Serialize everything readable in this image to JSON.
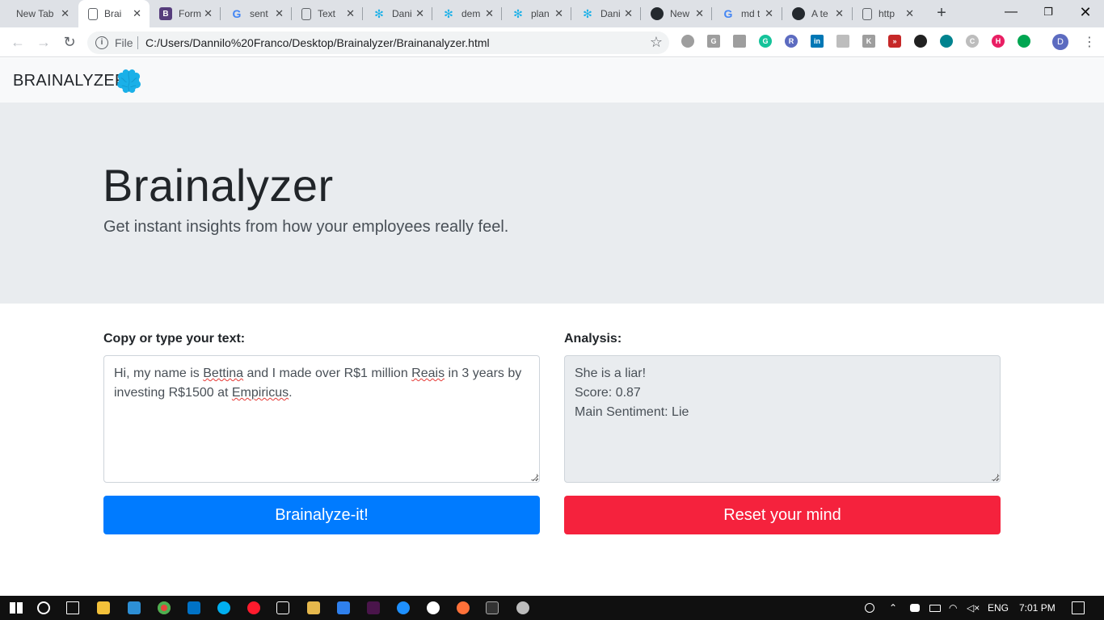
{
  "browser": {
    "tabs": [
      {
        "title": "New Tab",
        "icon": "none"
      },
      {
        "title": "Brai",
        "icon": "page-icon"
      },
      {
        "title": "Form",
        "icon": "bootstrap-icon"
      },
      {
        "title": "sent",
        "icon": "google-icon"
      },
      {
        "title": "Text",
        "icon": "page-icon"
      },
      {
        "title": "Dani",
        "icon": "network-icon"
      },
      {
        "title": "dem",
        "icon": "network-icon"
      },
      {
        "title": "plan",
        "icon": "network-icon"
      },
      {
        "title": "Dani",
        "icon": "network-icon"
      },
      {
        "title": "New",
        "icon": "github-icon"
      },
      {
        "title": "md t",
        "icon": "google-icon"
      },
      {
        "title": "A te",
        "icon": "github-icon"
      },
      {
        "title": "http",
        "icon": "page-icon"
      }
    ],
    "omnibox": {
      "scheme_label": "File",
      "url": "C:/Users/Dannilo%20Franco/Desktop/Brainalyzer/Brainanalyzer.html"
    },
    "profile_initial": "D"
  },
  "navbar": {
    "brand": "BRAINALYZER"
  },
  "jumbotron": {
    "title": "Brainalyzer",
    "lead": "Get instant insights from how your employees really feel."
  },
  "form": {
    "input_label": "Copy or type your text:",
    "input_value_parts": [
      "Hi, my name is ",
      "Bettina",
      " and I made over R$1 million ",
      "Reais",
      " in 3 years by investing R$1500 at ",
      "Empiricus",
      "."
    ],
    "output_label": "Analysis:",
    "output_lines": [
      "She is a liar!",
      "Score: 0.87",
      "Main Sentiment: Lie"
    ],
    "analyze_button": "Brainalyze-it!",
    "reset_button": "Reset your mind"
  },
  "taskbar": {
    "lang": "ENG",
    "time": "7:01 PM"
  },
  "colors": {
    "primary": "#007bff",
    "danger": "#f5223d",
    "jumbotron_bg": "#e9ecef",
    "navbar_bg": "#f8f9fa",
    "brain_logo": "#1ab0e8"
  }
}
